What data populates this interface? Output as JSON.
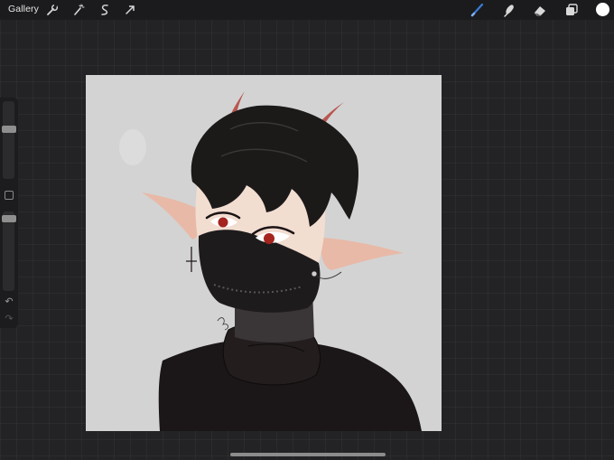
{
  "topbar": {
    "gallery_label": "Gallery",
    "left_tools": [
      "wrench-icon",
      "magic-wand-icon",
      "selection-icon",
      "transform-arrow-icon"
    ],
    "right_tools": [
      "brush-icon",
      "smudge-icon",
      "eraser-icon",
      "layers-icon"
    ],
    "brush_active_color": "#3a7bd5",
    "current_color": "#ffffff"
  },
  "sidebar": {
    "brush_size_level": 0.65,
    "opacity_level": 0.95,
    "controls": [
      "brush-size-slider",
      "modify-button",
      "opacity-slider",
      "undo-icon",
      "redo-icon"
    ]
  },
  "canvas": {
    "background_color": "#d3d3d3",
    "artwork": "character-illustration"
  }
}
